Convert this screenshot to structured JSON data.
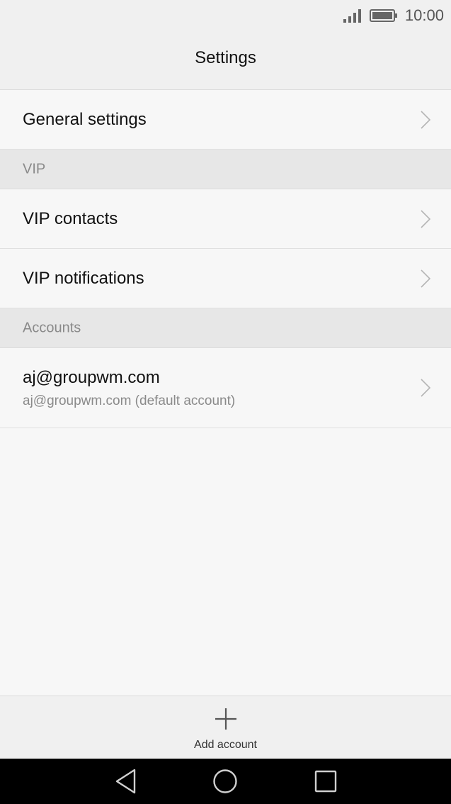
{
  "status_bar": {
    "time": "10:00",
    "icons": [
      "signal-icon",
      "battery-icon"
    ]
  },
  "header": {
    "title": "Settings"
  },
  "items": {
    "general": "General settings",
    "vip_section": "VIP",
    "vip_contacts": "VIP contacts",
    "vip_notifications": "VIP notifications",
    "accounts_section": "Accounts",
    "account_title": "aj@groupwm.com",
    "account_subtitle": "aj@groupwm.com (default account)"
  },
  "bottom": {
    "add_account_label": "Add account",
    "icon": "plus-icon"
  },
  "nav": {
    "icons": [
      "back-icon",
      "home-icon",
      "recents-icon"
    ]
  },
  "colors": {
    "background": "#f7f7f7",
    "bar": "#f0f0f0",
    "section": "#e7e7e7",
    "secondary_text": "#8a8a8a",
    "nav_bar": "#000000"
  }
}
